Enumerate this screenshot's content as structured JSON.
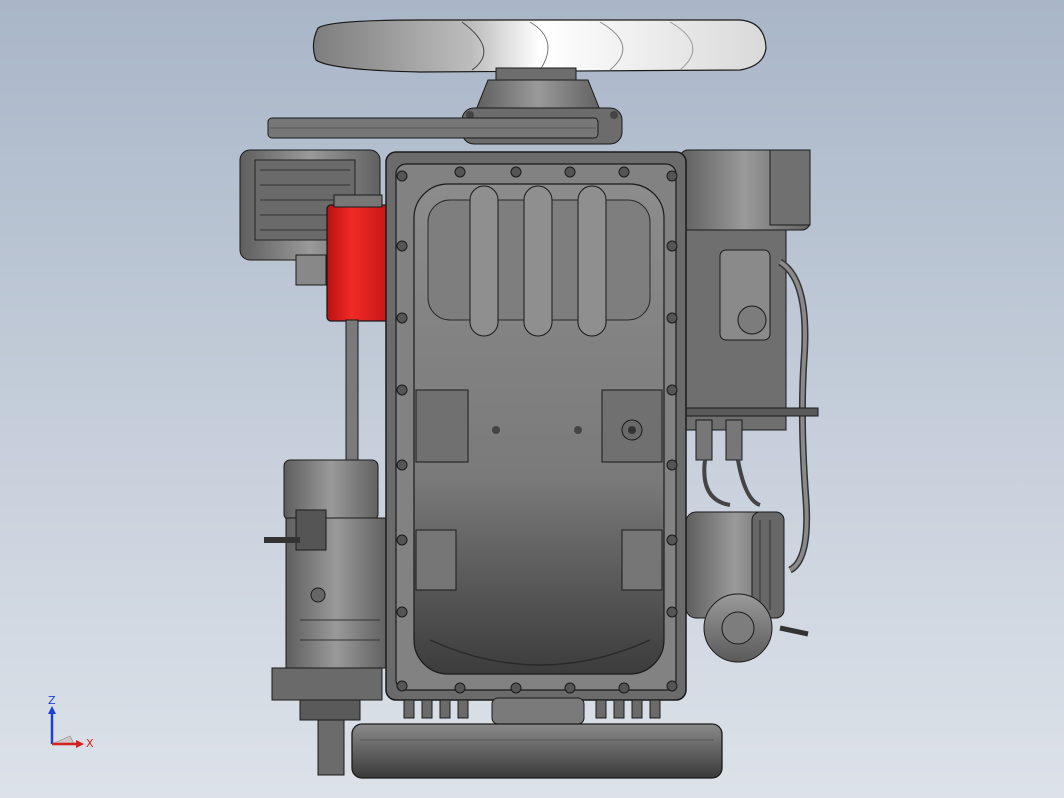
{
  "viewport": {
    "colors": {
      "background_top": "#a9b6c8",
      "background_bottom": "#dde2e9",
      "part_gray": "#8a8a8a",
      "part_dark": "#555555",
      "filter_red": "#e8201e",
      "fan_white": "#f4f4f4",
      "edge": "#1a1a1a"
    }
  },
  "triad": {
    "z_label": "Z",
    "x_label": "X",
    "z_color": "#1f3fd6",
    "x_color": "#d62020"
  }
}
